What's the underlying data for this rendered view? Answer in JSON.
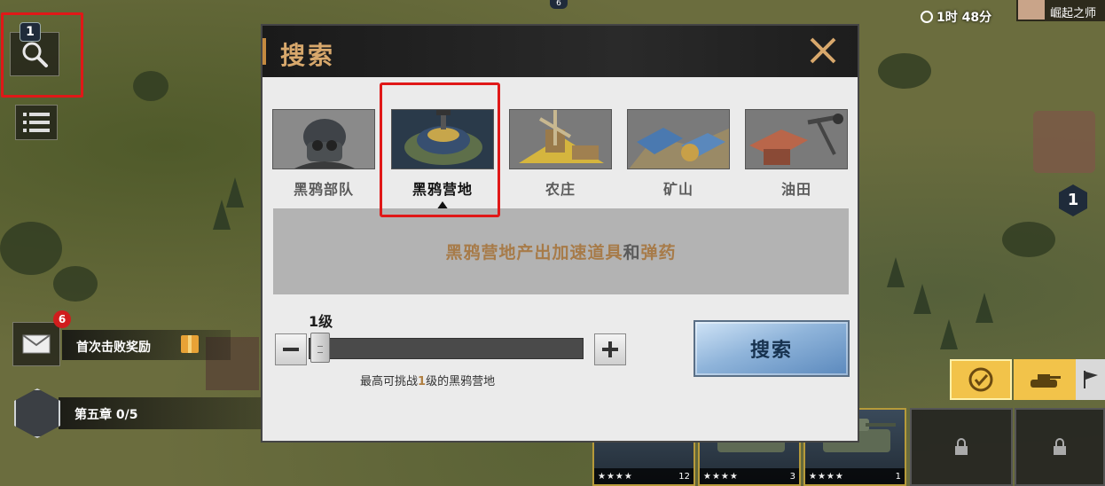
{
  "hud": {
    "search_badge": "1",
    "mail_badge": "6",
    "reward_label": "首次击败奖励",
    "chapter_label": "第五章 0/5",
    "timer": "1时 48分",
    "banner_text": "崛起之师",
    "map_count": "1",
    "top_count": "6"
  },
  "modal": {
    "title": "搜索",
    "categories": [
      {
        "label": "黑鸦部队",
        "icon": "soldier-icon"
      },
      {
        "label": "黑鸦营地",
        "icon": "camp-icon"
      },
      {
        "label": "农庄",
        "icon": "farm-icon"
      },
      {
        "label": "矿山",
        "icon": "mine-icon"
      },
      {
        "label": "油田",
        "icon": "oilfield-icon"
      }
    ],
    "selected_index": 1,
    "description": {
      "part1": "黑鸦营地产出",
      "part2": "加速道具",
      "part3": "和",
      "part4": "弹药"
    },
    "level_label": "1级",
    "level_value": 1,
    "max_text": {
      "prefix": "最高可挑战",
      "num": "1",
      "suffix": "级的黑鸦营地"
    },
    "search_button": "搜索"
  },
  "units": [
    {
      "count": "12",
      "stars": "★★★★"
    },
    {
      "count": "3",
      "stars": "★★★★"
    },
    {
      "count": "1",
      "stars": "★★★★"
    }
  ],
  "colors": {
    "title": "#d8a86c",
    "highlight": "#a77b49",
    "selection_box": "#e01818",
    "search_button": "#8fb4da"
  }
}
